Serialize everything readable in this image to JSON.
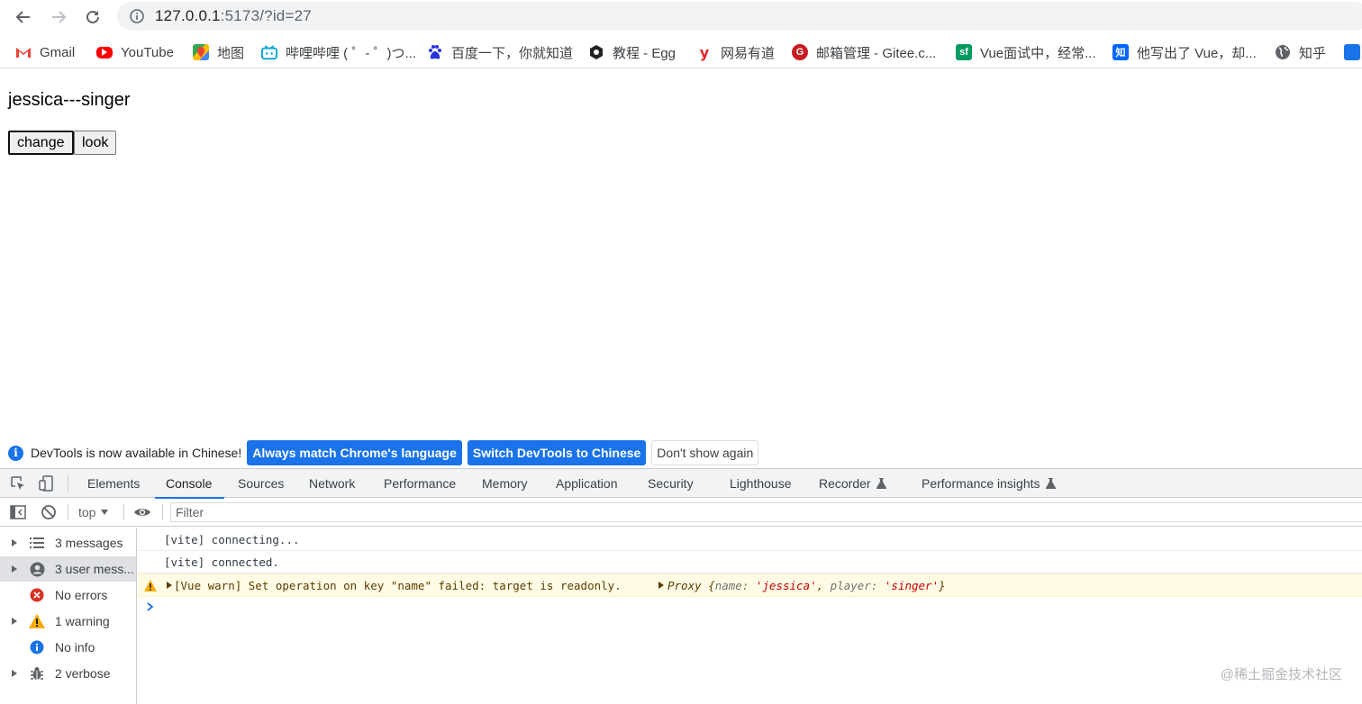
{
  "browser": {
    "url_host": "127.0.0.1",
    "url_rest": ":5173/?id=27",
    "bookmarks": [
      {
        "label": "Gmail",
        "icon": "gmail-icon",
        "color": "#ea4335"
      },
      {
        "label": "YouTube",
        "icon": "youtube-icon",
        "color": "#ff0000"
      },
      {
        "label": "地图",
        "icon": "maps-icon",
        "color": "#34a853"
      },
      {
        "label": "哔哩哔哩 ( ゜- ゜)つ...",
        "icon": "bilibili-icon",
        "color": "#00a1d6"
      },
      {
        "label": "百度一下，你就知道",
        "icon": "baidu-icon",
        "color": "#2932e1"
      },
      {
        "label": "教程 - Egg",
        "icon": "egg-icon",
        "color": "#222222"
      },
      {
        "label": "网易有道",
        "icon": "youdao-icon",
        "color": "#e3242b"
      },
      {
        "label": "邮箱管理 - Gitee.c...",
        "icon": "gitee-icon",
        "color": "#c71d23"
      },
      {
        "label": "Vue面试中，经常...",
        "icon": "segmentfault-icon",
        "color": "#009a61"
      },
      {
        "label": "他写出了 Vue，却...",
        "icon": "zhihu-icon",
        "color": "#0066ff"
      },
      {
        "label": "知乎",
        "icon": "globe-icon",
        "color": "#5f6368"
      }
    ]
  },
  "page": {
    "heading": "jessica---singer",
    "change_label": "change",
    "look_label": "look"
  },
  "devtools": {
    "infobar": {
      "message": "DevTools is now available in Chinese!",
      "btn_match": "Always match Chrome's language",
      "btn_switch": "Switch DevTools to Chinese",
      "btn_dismiss": "Don't show again"
    },
    "tabs": [
      "Elements",
      "Console",
      "Sources",
      "Network",
      "Performance",
      "Memory",
      "Application",
      "Security",
      "Lighthouse",
      "Recorder",
      "Performance insights"
    ],
    "active_tab": "Console",
    "context": "top",
    "filter_placeholder": "Filter",
    "sidebar": [
      {
        "label": "3 messages",
        "icon": "list-icon"
      },
      {
        "label": "3 user mess...",
        "icon": "user-icon"
      },
      {
        "label": "No errors",
        "icon": "error-icon"
      },
      {
        "label": "1 warning",
        "icon": "warning-icon"
      },
      {
        "label": "No info",
        "icon": "info-icon"
      },
      {
        "label": "2 verbose",
        "icon": "bug-icon"
      }
    ],
    "logs": {
      "line1": "[vite] connecting...",
      "line2": "[vite] connected.",
      "warn_text": "[Vue warn] Set operation on key \"name\" failed: target is readonly.",
      "proxy_label": "Proxy",
      "proxy_open": "{",
      "proxy_key1": "name:",
      "proxy_val1": "'jessica'",
      "proxy_comma": ",",
      "proxy_key2": "player:",
      "proxy_val2": "'singer'",
      "proxy_close": "}"
    }
  },
  "watermark": "@稀土掘金技术社区",
  "colors": {
    "accent": "#1a73e8",
    "warning_bg": "#fffbe5",
    "error": "#d93025",
    "warning": "#f9ab00"
  }
}
